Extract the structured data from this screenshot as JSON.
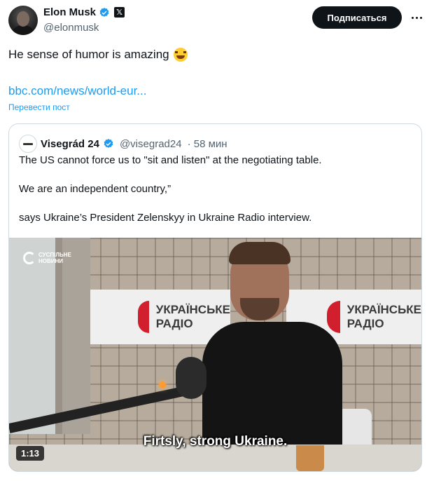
{
  "author": {
    "name": "Elon Musk",
    "handle": "@elonmusk",
    "avatar_icon": "profile-photo",
    "badges": [
      "verified-icon",
      "x-affiliation-icon"
    ]
  },
  "header": {
    "subscribe_label": "Подписаться",
    "more_icon": "more-horizontal-icon"
  },
  "tweet": {
    "text": "He sense of humor is amazing",
    "emoji": "😂",
    "link": "bbc.com/news/world-eur...",
    "translate_label": "Перевести пост"
  },
  "quote": {
    "name": "Visegrád 24",
    "handle": "@visegrad24",
    "time": "· 58 мин",
    "lines": [
      "The US cannot force us to \"sit and listen\" at the negotiating table.",
      "We are an independent country,”",
      "says Ukraine’s President Zelenskyy in Ukraine Radio interview."
    ],
    "video": {
      "channel_logo": [
        "СУСПІЛЬНЕ",
        "НОВИНИ"
      ],
      "banner_text": [
        "УКРАЇНСЬКЕ",
        "РАДІО"
      ],
      "subtitle": "Firtsly, strong Ukraine.",
      "duration": "1:13"
    }
  },
  "colors": {
    "accent": "#1d9bf0",
    "text": "#0f1419",
    "muted": "#536471",
    "border": "#cfd9de",
    "button_bg": "#0f1419",
    "banner_red": "#d11f2d"
  }
}
